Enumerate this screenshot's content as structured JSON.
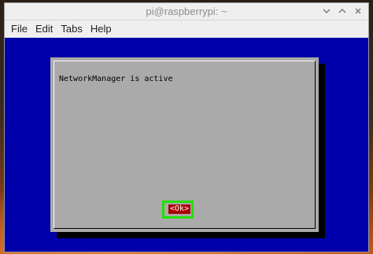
{
  "window": {
    "title": "pi@raspberrypi: ~"
  },
  "menu": {
    "items": [
      "File",
      "Edit",
      "Tabs",
      "Help"
    ]
  },
  "dialog": {
    "message": "NetworkManager is active",
    "ok_label": "<Ok>"
  },
  "colors": {
    "terminal_bg": "#0000aa",
    "dialog_bg": "#aaaaaa",
    "button_bg": "#aa0000",
    "highlight": "#22e000"
  },
  "icons": [
    "minimize-icon",
    "maximize-icon",
    "close-icon"
  ]
}
